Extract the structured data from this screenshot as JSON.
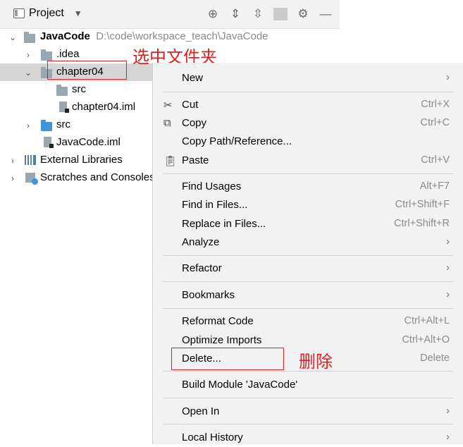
{
  "project_panel": {
    "title": "Project",
    "header_icons": [
      "locate-icon",
      "expand-all-icon",
      "collapse-all-icon",
      "gear-icon",
      "minimize-icon"
    ]
  },
  "tree": {
    "root": {
      "name": "JavaCode",
      "path": "D:\\code\\workspace_teach\\JavaCode"
    },
    "idea": ".idea",
    "chapter04": "chapter04",
    "ch_src": "src",
    "ch_iml": "chapter04.iml",
    "src": "src",
    "iml": "JavaCode.iml",
    "ext_libs": "External Libraries",
    "scratches": "Scratches and Consoles"
  },
  "annotations": {
    "select_folder": "选中文件夹",
    "delete": "删除"
  },
  "menu": {
    "new": "New",
    "cut": "Cut",
    "cut_key": "Ctrl+X",
    "copy": "Copy",
    "copy_key": "Ctrl+C",
    "copy_path": "Copy Path/Reference...",
    "paste": "Paste",
    "paste_key": "Ctrl+V",
    "find_usages": "Find Usages",
    "find_usages_key": "Alt+F7",
    "find_in_files": "Find in Files...",
    "find_in_files_key": "Ctrl+Shift+F",
    "replace_in_files": "Replace in Files...",
    "replace_in_files_key": "Ctrl+Shift+R",
    "analyze": "Analyze",
    "refactor": "Refactor",
    "bookmarks": "Bookmarks",
    "reformat": "Reformat Code",
    "reformat_key": "Ctrl+Alt+L",
    "optimize": "Optimize Imports",
    "optimize_key": "Ctrl+Alt+O",
    "delete": "Delete...",
    "delete_key": "Delete",
    "build_module": "Build Module 'JavaCode'",
    "open_in": "Open In",
    "local_history": "Local History"
  }
}
